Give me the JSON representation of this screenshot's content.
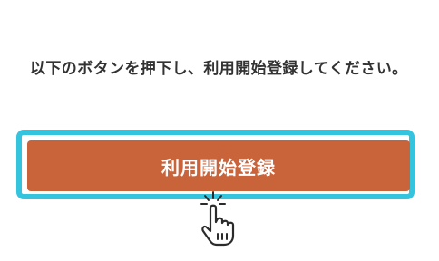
{
  "instruction": {
    "text": "以下のボタンを押下し、利用開始登録してください。"
  },
  "start_button": {
    "label": "利用開始登録"
  },
  "colors": {
    "button_bg": "#c9633a",
    "highlight": "#35c4de",
    "text": "#333333"
  },
  "icons": {
    "cursor": "hand-pointer-click-icon"
  }
}
